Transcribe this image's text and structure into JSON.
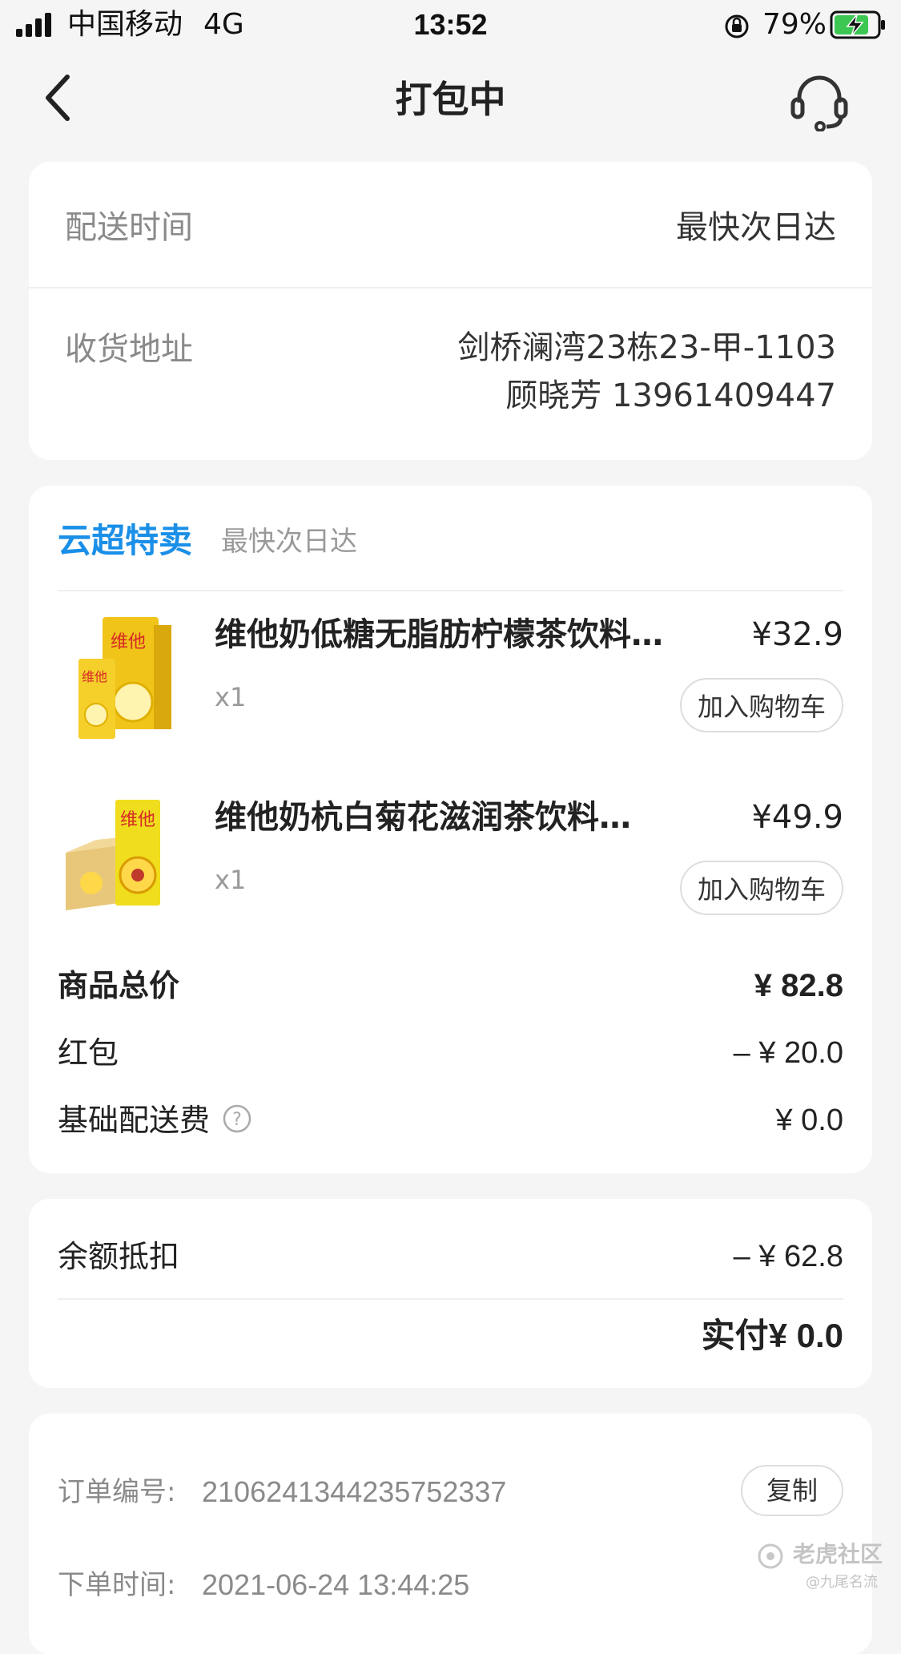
{
  "status_bar": {
    "carrier": "中国移动",
    "network": "4G",
    "time": "13:52",
    "battery": "79%"
  },
  "nav": {
    "title": "打包中",
    "back_icon": "chevron-left-icon",
    "support_icon": "headset-icon"
  },
  "delivery": {
    "time_label": "配送时间",
    "time_value": "最快次日达",
    "address_label": "收货地址",
    "address_line1": "剑桥澜湾23栋23-甲-1103",
    "address_line2": "顾晓芳 13961409447"
  },
  "store": {
    "name": "云超特卖",
    "delivery_tag": "最快次日达",
    "accent_color": "#1a8fe8"
  },
  "products": [
    {
      "title": "维他奶低糖无脂肪柠檬茶饮料…",
      "price": "¥32.9",
      "qty": "x1",
      "add_to_cart": "加入购物车"
    },
    {
      "title": "维他奶杭白菊花滋润茶饮料…",
      "price": "¥49.9",
      "qty": "x1",
      "add_to_cart": "加入购物车"
    }
  ],
  "summary": {
    "subtotal_label": "商品总价",
    "subtotal_value": "¥ 82.8",
    "coupon_label": "红包",
    "coupon_value": "– ¥ 20.0",
    "delivery_fee_label": "基础配送费",
    "delivery_fee_value": "¥ 0.0"
  },
  "payment": {
    "balance_label": "余额抵扣",
    "balance_value": "– ¥ 62.8",
    "paid_label": "实付",
    "paid_value": "¥ 0.0"
  },
  "order": {
    "number_label": "订单编号:",
    "number_value": "2106241344235752337",
    "copy_button": "复制",
    "time_label": "下单时间:",
    "time_value": "2021-06-24 13:44:25"
  },
  "watermark": {
    "brand": "老虎社区",
    "author": "@九尾名流"
  }
}
